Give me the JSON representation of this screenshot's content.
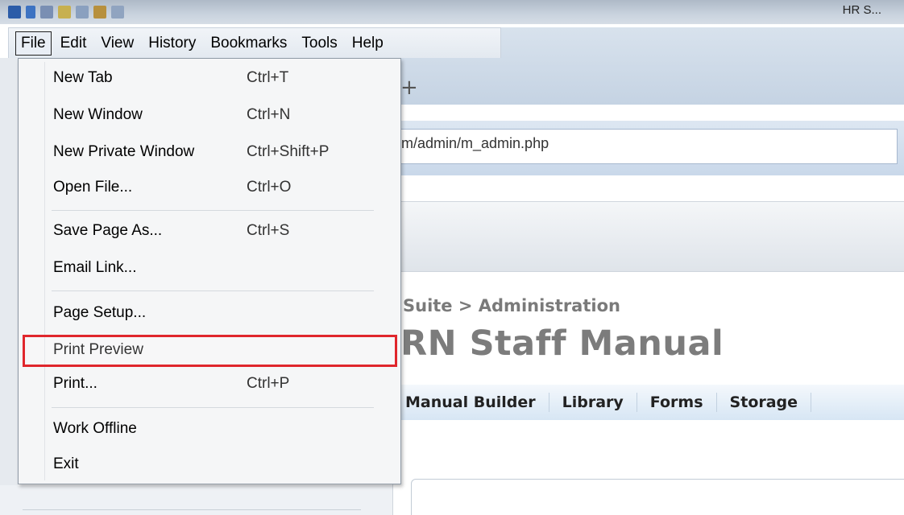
{
  "window": {
    "title": "HR S..."
  },
  "menubar": {
    "items": [
      {
        "label": "File",
        "active": true
      },
      {
        "label": "Edit"
      },
      {
        "label": "View"
      },
      {
        "label": "History"
      },
      {
        "label": "Bookmarks"
      },
      {
        "label": "Tools"
      },
      {
        "label": "Help"
      }
    ]
  },
  "browser": {
    "new_tab_icon": "+",
    "url": "m/admin/m_admin.php"
  },
  "file_menu": {
    "items": [
      {
        "label": "New Tab",
        "shortcut": "Ctrl+T"
      },
      {
        "label": "New Window",
        "shortcut": "Ctrl+N"
      },
      {
        "label": "New Private Window",
        "shortcut": "Ctrl+Shift+P"
      },
      {
        "label": "Open File...",
        "shortcut": "Ctrl+O"
      },
      {
        "label": "Save Page As...",
        "shortcut": "Ctrl+S"
      },
      {
        "label": "Email Link...",
        "shortcut": ""
      },
      {
        "label": "Page Setup...",
        "shortcut": ""
      },
      {
        "label": "Print Preview",
        "shortcut": "",
        "highlighted": true
      },
      {
        "label": "Print...",
        "shortcut": "Ctrl+P"
      },
      {
        "label": "Work Offline",
        "shortcut": ""
      },
      {
        "label": "Exit",
        "shortcut": ""
      }
    ],
    "highlight_color": "#e0262c"
  },
  "page": {
    "breadcrumb": "Suite > Administration",
    "title": "RN Staff Manual",
    "nav": [
      "Manual Builder",
      "Library",
      "Forms",
      "Storage"
    ]
  }
}
